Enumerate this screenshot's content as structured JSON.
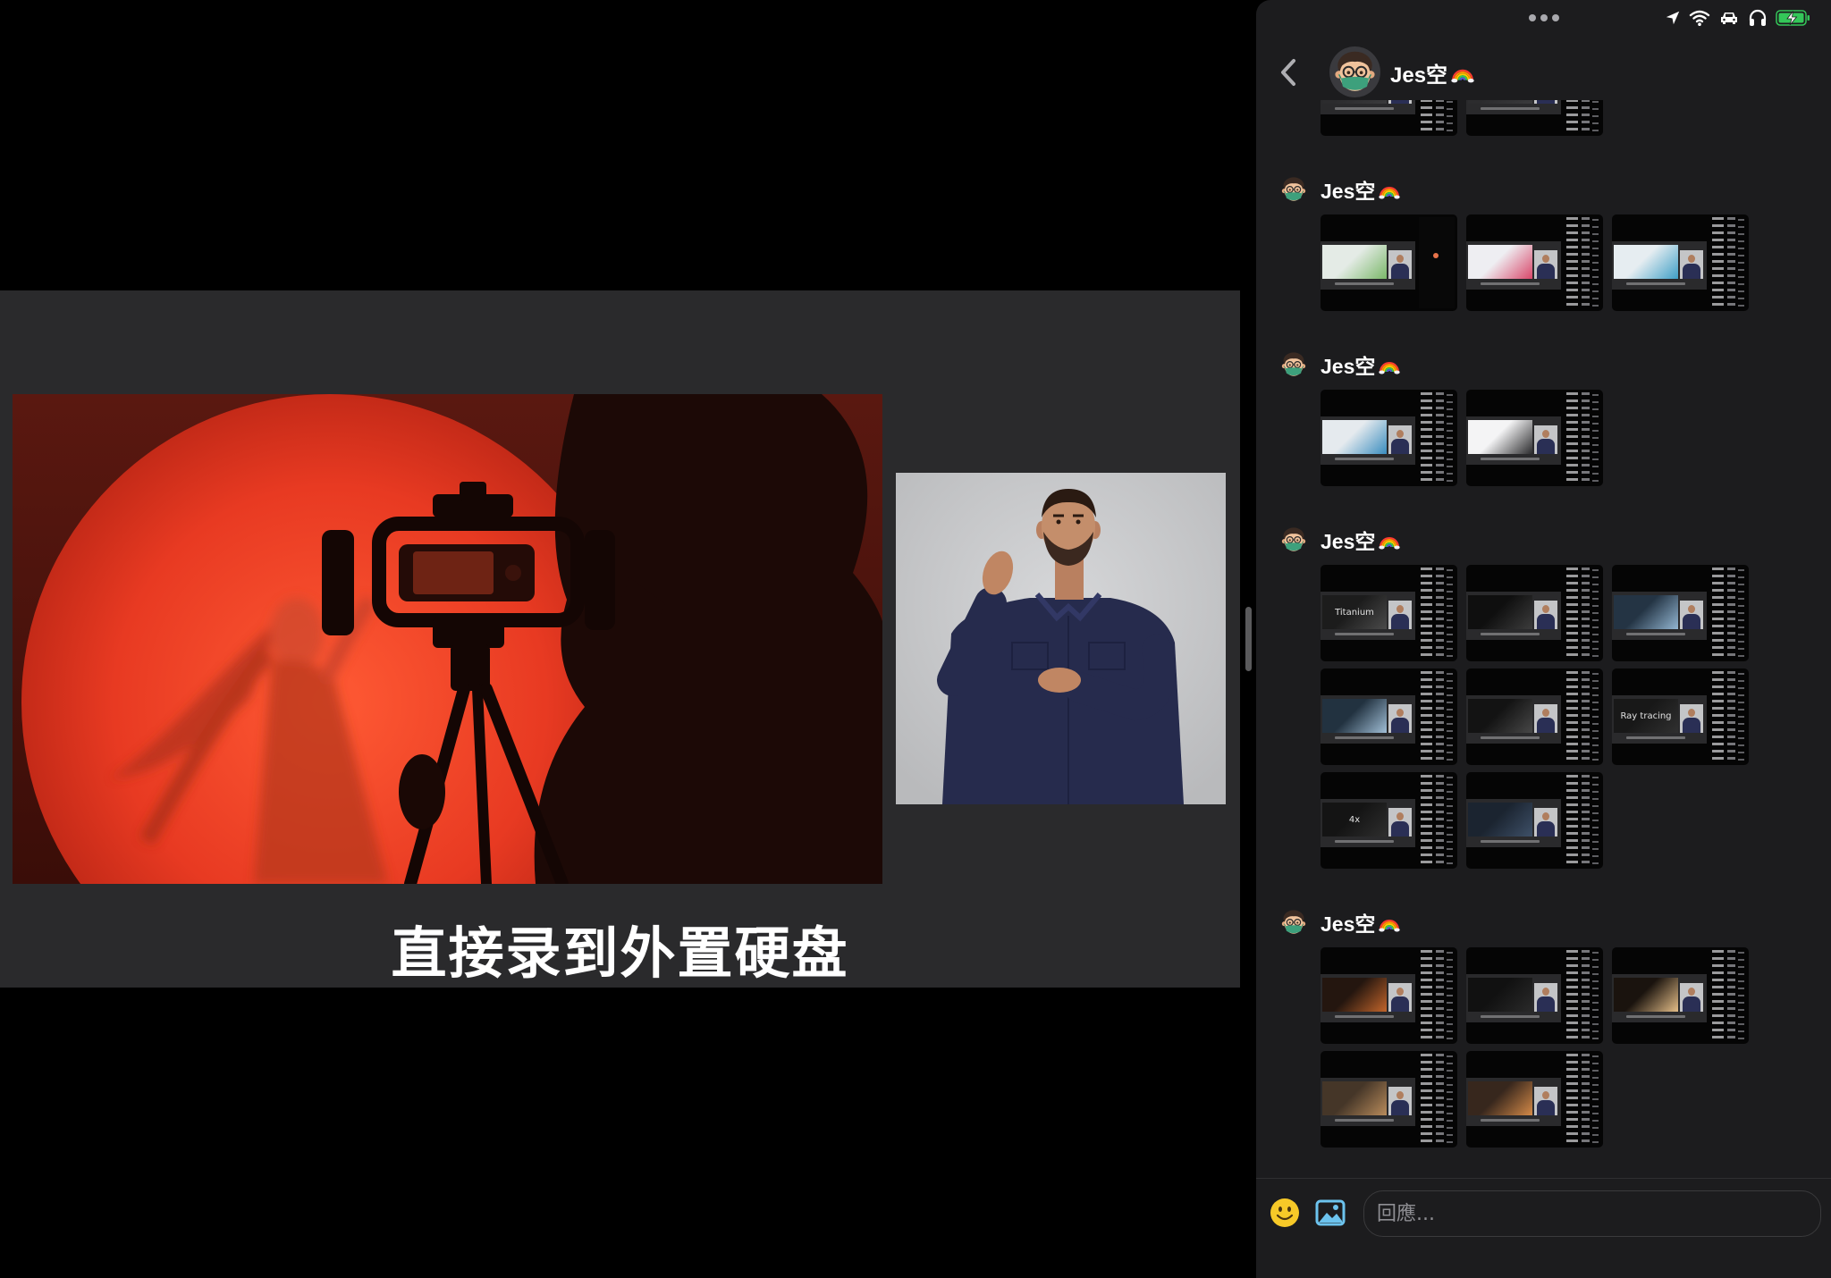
{
  "app": {
    "subtitle": "直接录到外置硬盘"
  },
  "status_bar": {
    "icons": [
      "location-arrow-icon",
      "wifi-icon",
      "car-icon",
      "headphones-icon",
      "battery-charging-icon"
    ],
    "battery_color": "#34c759"
  },
  "chat": {
    "contact_name": "Jes空",
    "contact_emoji_icon": "rainbow-icon",
    "partial_thumbs": [
      {
        "colors": [
          "#2c2c2e",
          "#3a3a3c"
        ]
      },
      {
        "colors": [
          "#2c2c2e",
          "#3a3a3c"
        ]
      }
    ],
    "messages": [
      {
        "sender": "Jes空",
        "thumbs": [
          {
            "colors": [
              "#e4ebe6",
              "#7bb86a"
            ],
            "panel_dot": "#e8734a"
          },
          {
            "colors": [
              "#eeeef2",
              "#d9476a"
            ]
          },
          {
            "colors": [
              "#e6edf1",
              "#3f9fc6"
            ]
          }
        ]
      },
      {
        "sender": "Jes空",
        "thumbs": [
          {
            "colors": [
              "#e5eaee",
              "#3a8dbf"
            ]
          },
          {
            "colors": [
              "#f4f4f5",
              "#2a2a2c"
            ]
          }
        ]
      },
      {
        "sender": "Jes空",
        "thumbs": [
          {
            "colors": [
              "#1c1c1c",
              "#4a4a4a"
            ],
            "label": "Titanium"
          },
          {
            "colors": [
              "#0f0f0f",
              "#3c3c3c"
            ]
          },
          {
            "colors": [
              "#243444",
              "#93b6d2"
            ]
          },
          {
            "colors": [
              "#223240",
              "#a0bed6"
            ]
          },
          {
            "colors": [
              "#131313",
              "#474747"
            ]
          },
          {
            "colors": [
              "#181818",
              "#303030"
            ],
            "label": "Ray tracing"
          },
          {
            "colors": [
              "#141414",
              "#2e2e2e"
            ],
            "label": "4x"
          },
          {
            "colors": [
              "#1b2430",
              "#3e5068"
            ]
          }
        ]
      },
      {
        "sender": "Jes空",
        "thumbs": [
          {
            "colors": [
              "#24160f",
              "#c2652b"
            ]
          },
          {
            "colors": [
              "#111111",
              "#2a2a2a"
            ]
          },
          {
            "colors": [
              "#1a130e",
              "#e5be88"
            ]
          },
          {
            "colors": [
              "#453628",
              "#b88b5b"
            ]
          },
          {
            "colors": [
              "#37271d",
              "#d48a48"
            ]
          }
        ]
      }
    ],
    "composer": {
      "placeholder": "回應...",
      "emoji_icon": "smiley-icon",
      "photo_icon": "photo-icon"
    }
  },
  "colors": {
    "panel_bg": "#1c1c1e",
    "video_frame_bg": "#2a2a2c",
    "emoji_yellow": "#f7c928",
    "photo_blue": "#6cc3ee"
  }
}
